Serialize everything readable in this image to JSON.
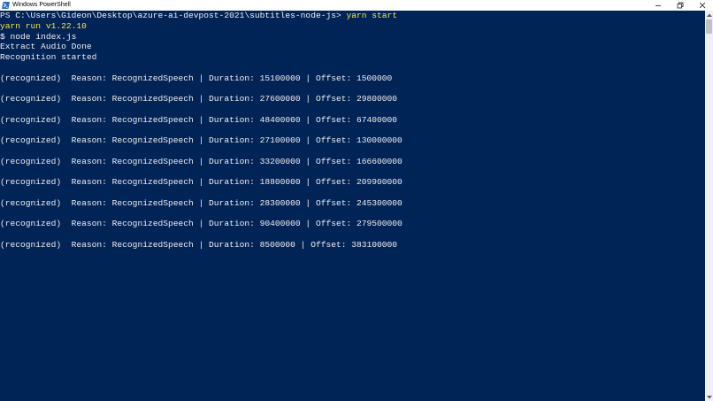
{
  "window": {
    "title": "Windows PowerShell",
    "icon": "powershell-icon",
    "controls": {
      "minimize": "minimize-icon",
      "maximize": "restore-icon",
      "close": "close-icon"
    }
  },
  "console": {
    "prompt": "PS C:\\Users\\Gideon\\Desktop\\azure-ai-devpost-2021\\subtitles-node-js> ",
    "command": "yarn start",
    "yarn_version": "yarn run v1.22.10",
    "node_cmd": "$ node index.js",
    "extract_msg": "Extract Audio Done",
    "recognition_msg": "Recognition started",
    "results": [
      "(recognized)  Reason: RecognizedSpeech | Duration: 15100000 | Offset: 1500000",
      "(recognized)  Reason: RecognizedSpeech | Duration: 27600000 | Offset: 29800000",
      "(recognized)  Reason: RecognizedSpeech | Duration: 48400000 | Offset: 67400000",
      "(recognized)  Reason: RecognizedSpeech | Duration: 27100000 | Offset: 130000000",
      "(recognized)  Reason: RecognizedSpeech | Duration: 33200000 | Offset: 166600000",
      "(recognized)  Reason: RecognizedSpeech | Duration: 18800000 | Offset: 209900000",
      "(recognized)  Reason: RecognizedSpeech | Duration: 28300000 | Offset: 245300000",
      "(recognized)  Reason: RecognizedSpeech | Duration: 90400000 | Offset: 279500000",
      "(recognized)  Reason: RecognizedSpeech | Duration: 8500000 | Offset: 383100000"
    ]
  },
  "colors": {
    "background": "#012456",
    "text": "#eeedf0",
    "command": "#f4e542"
  }
}
